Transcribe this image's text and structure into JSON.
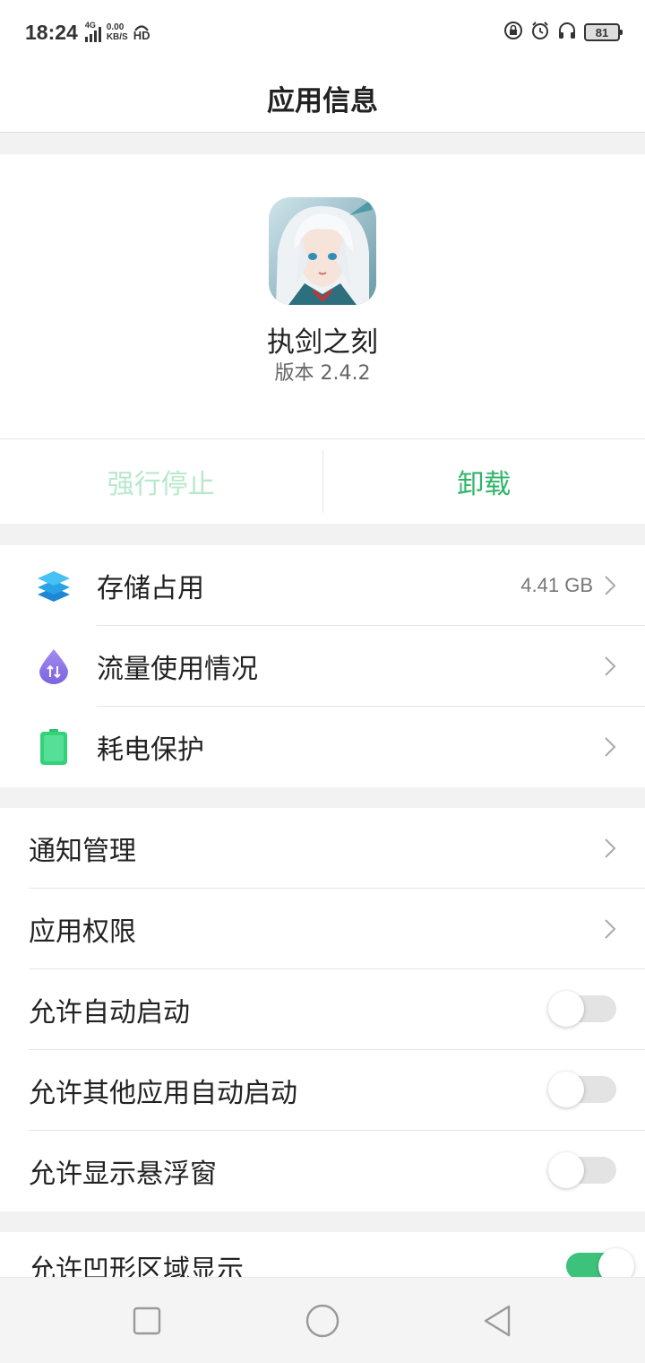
{
  "status_bar": {
    "time": "18:24",
    "network_speed_value": "0.00",
    "network_speed_unit": "KB/S",
    "network_type": "4G",
    "hd_label": "HD",
    "battery_level": "81"
  },
  "header": {
    "title": "应用信息"
  },
  "app": {
    "name": "执剑之刻",
    "version": "版本 2.4.2",
    "force_stop_label": "强行停止",
    "uninstall_label": "卸载",
    "force_stop_color": "#b8e8cc",
    "uninstall_color": "#2fb56a"
  },
  "usage_group": [
    {
      "label": "存储占用",
      "value": "4.41 GB",
      "icon": "layers-icon"
    },
    {
      "label": "流量使用情况",
      "value": "",
      "icon": "data-drop-icon"
    },
    {
      "label": "耗电保护",
      "value": "",
      "icon": "battery-icon"
    }
  ],
  "settings_group": [
    {
      "label": "通知管理",
      "type": "link"
    },
    {
      "label": "应用权限",
      "type": "link"
    },
    {
      "label": "允许自动启动",
      "type": "toggle",
      "enabled": false
    },
    {
      "label": "允许其他应用自动启动",
      "type": "toggle",
      "enabled": false
    },
    {
      "label": "允许显示悬浮窗",
      "type": "toggle",
      "enabled": false
    }
  ],
  "display_group": [
    {
      "label": "允许凹形区域显示",
      "type": "toggle",
      "enabled": true
    }
  ],
  "accent_color": "#3cc27b",
  "nav_bar": {
    "icons": [
      "recent-apps-icon",
      "home-icon",
      "back-icon"
    ]
  }
}
